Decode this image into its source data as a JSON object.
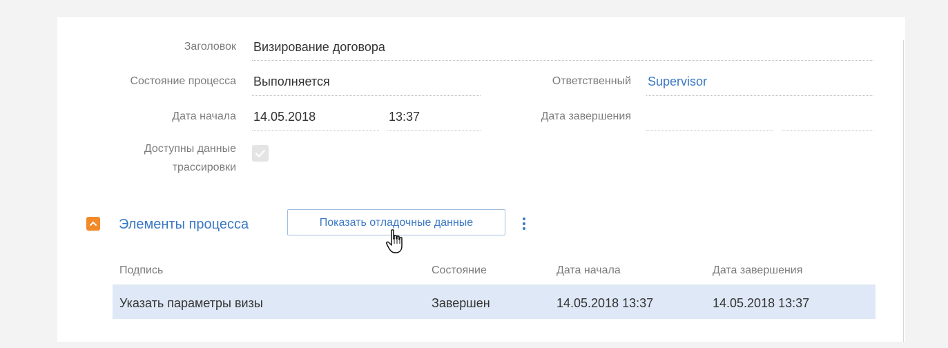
{
  "form": {
    "title_label": "Заголовок",
    "title_value": "Визирование договора",
    "state_label": "Состояние процесса",
    "state_value": "Выполняется",
    "owner_label": "Ответственный",
    "owner_value": "Supervisor",
    "start_label": "Дата начала",
    "start_date": "14.05.2018",
    "start_time": "13:37",
    "end_label": "Дата завершения",
    "end_date": "",
    "end_time": "",
    "trace_label_line1": "Доступны данные",
    "trace_label_line2": "трассировки",
    "trace_checked": true
  },
  "elements_group": {
    "title": "Элементы процесса",
    "debug_button": "Показать отладочные данные",
    "columns": [
      "Подпись",
      "Состояние",
      "Дата начала",
      "Дата завершения"
    ],
    "rows": [
      {
        "caption": "Указать параметры визы",
        "state": "Завершен",
        "start": "14.05.2018 13:37",
        "end": "14.05.2018 13:37"
      }
    ]
  },
  "colors": {
    "accent_link": "#3a78c4",
    "collapse_button": "#f28a2a",
    "selected_row": "#dfe8f6"
  },
  "icons": {
    "collapse": "chevron-up-icon",
    "menu": "vertical-ellipsis-icon",
    "cursor": "hand-pointer-cursor-icon",
    "checkbox": "checkmark-icon"
  }
}
